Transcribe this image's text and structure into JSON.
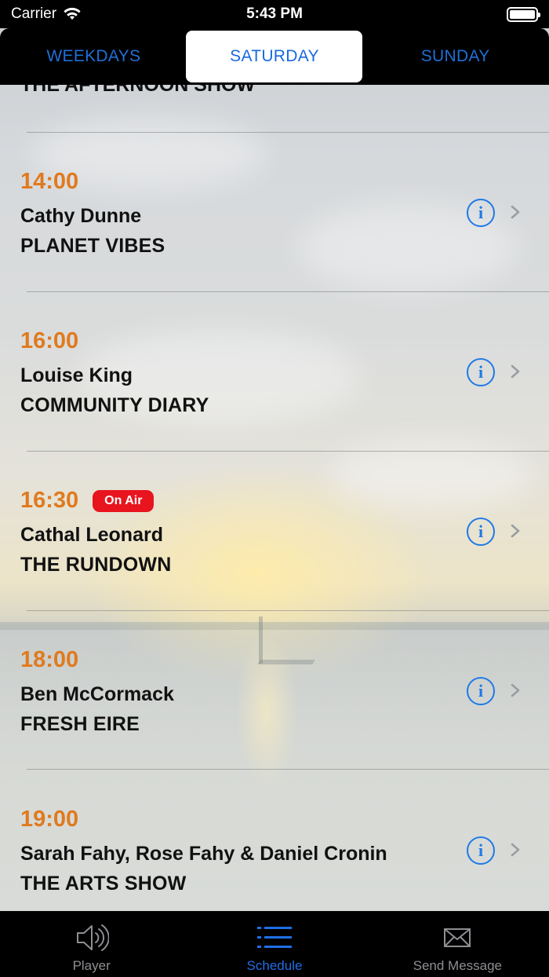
{
  "status_bar": {
    "carrier": "Carrier",
    "time": "5:43 PM"
  },
  "segments": [
    {
      "label": "WEEKDAYS",
      "active": false
    },
    {
      "label": "SATURDAY",
      "active": true
    },
    {
      "label": "SUNDAY",
      "active": false
    }
  ],
  "partial_row": {
    "show": "THE AFTERNOON SHOW"
  },
  "schedule": [
    {
      "time": "14:00",
      "host": "Cathy Dunne",
      "show": "PLANET VIBES",
      "on_air": false
    },
    {
      "time": "16:00",
      "host": "Louise King",
      "show": "COMMUNITY DIARY",
      "on_air": false
    },
    {
      "time": "16:30",
      "host": "Cathal Leonard",
      "show": "THE RUNDOWN",
      "on_air": true,
      "badge": "On Air"
    },
    {
      "time": "18:00",
      "host": "Ben McCormack",
      "show": "FRESH EIRE",
      "on_air": false
    },
    {
      "time": "19:00",
      "host": "Sarah Fahy, Rose Fahy & Daniel Cronin",
      "show": "THE ARTS SHOW",
      "on_air": false
    }
  ],
  "info_glyph": "i",
  "tab_bar": [
    {
      "label": "Player",
      "icon": "speaker-icon",
      "active": false
    },
    {
      "label": "Schedule",
      "icon": "list-icon",
      "active": true
    },
    {
      "label": "Send Message",
      "icon": "envelope-icon",
      "active": false
    }
  ],
  "colors": {
    "accent": "#1f6fe6",
    "time": "#e07a1e",
    "on_air": "#e8141e"
  }
}
